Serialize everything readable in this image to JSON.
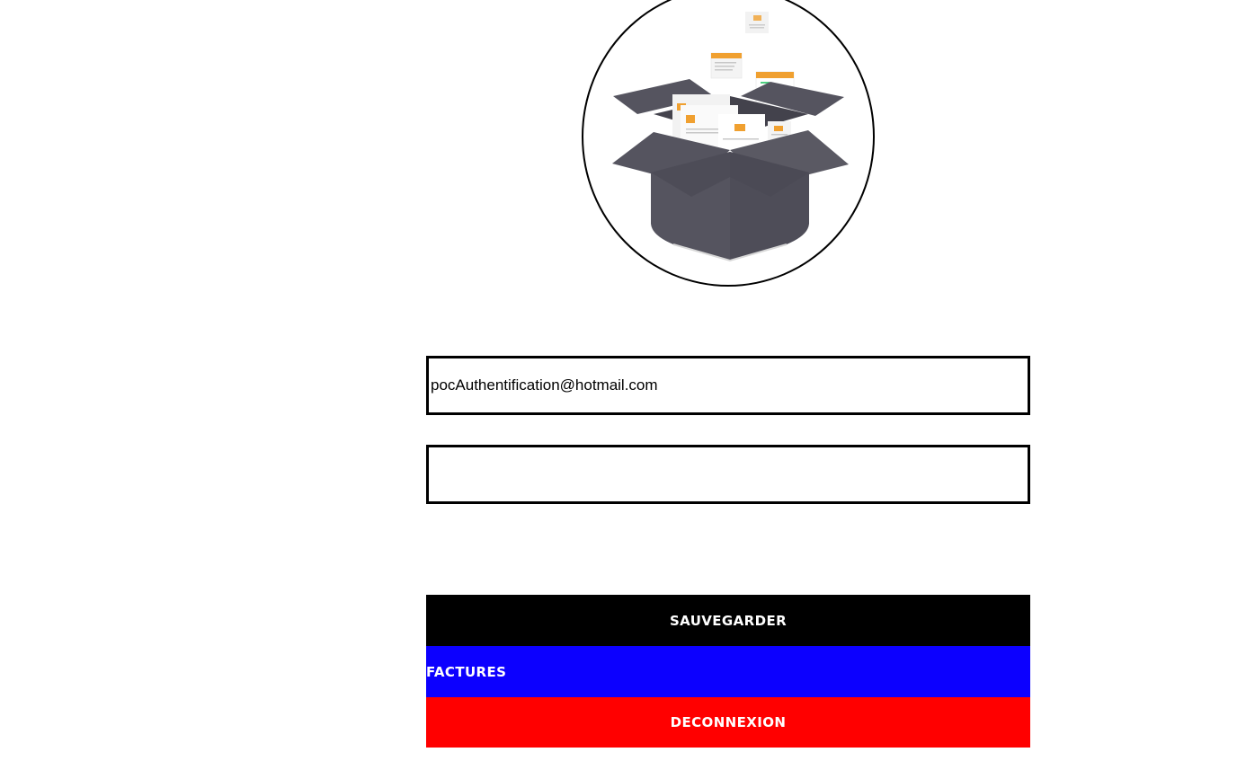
{
  "logo": {
    "icon": "open-box-with-documents-icon",
    "box_color": "#55545f",
    "accent_color": "#f0a030"
  },
  "form": {
    "email_value": "pocAuthentification@hotmail.com",
    "password_value": ""
  },
  "actions": {
    "save_label": "SAUVEGARDER",
    "save_color": "#000000",
    "invoices_label": "FACTURES",
    "invoices_color": "#0c00ff",
    "logout_label": "DECONNEXION",
    "logout_color": "#ff0000"
  }
}
